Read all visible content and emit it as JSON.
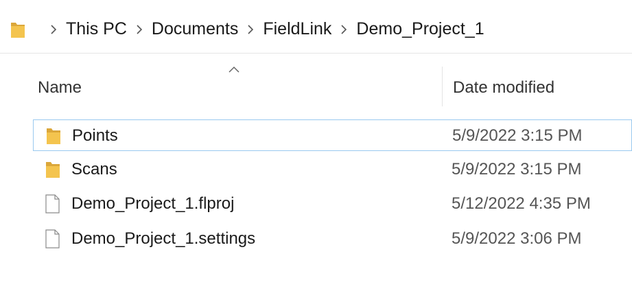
{
  "breadcrumb": {
    "items": [
      "This PC",
      "Documents",
      "FieldLink",
      "Demo_Project_1"
    ],
    "folder_icon": "folder-icon",
    "separator_icon": "chevron-right-icon"
  },
  "columns": {
    "name": "Name",
    "date_modified": "Date modified",
    "sort_indicator": "sort-ascending-icon"
  },
  "files": [
    {
      "name": "Points",
      "date": "5/9/2022 3:15 PM",
      "type": "folder",
      "icon": "folder-icon",
      "selected": true
    },
    {
      "name": "Scans",
      "date": "5/9/2022 3:15 PM",
      "type": "folder",
      "icon": "folder-icon",
      "selected": false
    },
    {
      "name": "Demo_Project_1.flproj",
      "date": "5/12/2022 4:35 PM",
      "type": "file",
      "icon": "file-icon",
      "selected": false
    },
    {
      "name": "Demo_Project_1.settings",
      "date": "5/9/2022 3:06 PM",
      "type": "file",
      "icon": "file-icon",
      "selected": false
    }
  ],
  "colors": {
    "folder": "#f4c44e",
    "folder_dark": "#dba73a",
    "selection_border": "#99c9ef"
  }
}
